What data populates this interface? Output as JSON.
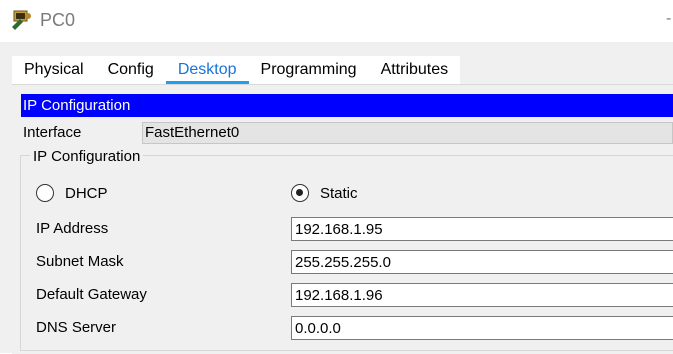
{
  "window": {
    "title": "PC0",
    "minimize_glyph": "-",
    "icon": "pc-icon"
  },
  "tabs": [
    {
      "label": "Physical",
      "active": false
    },
    {
      "label": "Config",
      "active": false
    },
    {
      "label": "Desktop",
      "active": true
    },
    {
      "label": "Programming",
      "active": false
    },
    {
      "label": "Attributes",
      "active": false
    }
  ],
  "ip_config": {
    "header": "IP Configuration",
    "interface_label": "Interface",
    "interface_value": "FastEthernet0",
    "group_title": "IP Configuration",
    "dhcp_label": "DHCP",
    "static_label": "Static",
    "selected_mode": "Static",
    "fields": {
      "ip_address": {
        "label": "IP Address",
        "value": "192.168.1.95"
      },
      "subnet_mask": {
        "label": "Subnet Mask",
        "value": "255.255.255.0"
      },
      "default_gateway": {
        "label": "Default Gateway",
        "value": "192.168.1.96"
      },
      "dns_server": {
        "label": "DNS Server",
        "value": "0.0.0.0"
      }
    }
  },
  "colors": {
    "header_bg": "#0000ff",
    "active_tab_text": "#1a73d9",
    "active_tab_underline": "#1ea0e8"
  }
}
